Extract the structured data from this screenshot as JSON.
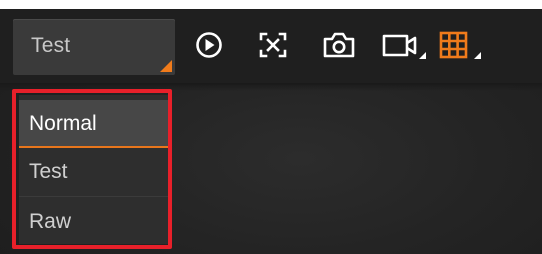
{
  "mode_select": {
    "value": "Test",
    "options": [
      "Normal",
      "Test",
      "Raw"
    ],
    "selected_option": "Normal"
  },
  "toolbar": {
    "icons": [
      "play-icon",
      "fit-screen-icon",
      "camera-icon",
      "video-icon",
      "grid-icon"
    ]
  },
  "colors": {
    "accent": "#f07b1b",
    "highlight": "#e8202a",
    "panel": "#1f1f1f"
  }
}
